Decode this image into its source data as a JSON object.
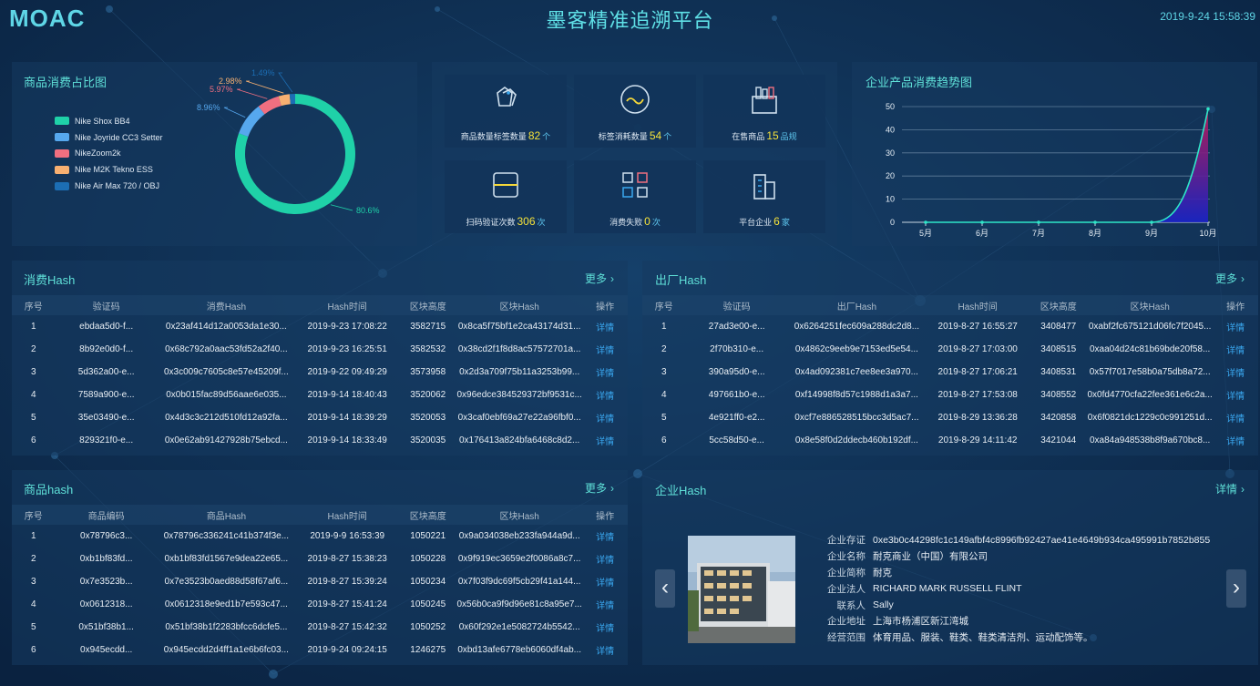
{
  "header": {
    "logo": "MOAC",
    "title": "墨客精准追溯平台",
    "datetime": "2019-9-24 15:58:39"
  },
  "pie_panel": {
    "title": "商品消费占比图",
    "legend": [
      {
        "label": "Nike Shox BB4",
        "color": "#1fd1a8"
      },
      {
        "label": "Nike Joyride CC3 Setter",
        "color": "#56a8ee"
      },
      {
        "label": "NikeZoom2k",
        "color": "#f06f80"
      },
      {
        "label": "Nike M2K Tekno ESS",
        "color": "#f7b071"
      },
      {
        "label": "Nike Air Max 720 / OBJ",
        "color": "#1c6eb4"
      }
    ],
    "labels": [
      "80.6%",
      "8.96%",
      "5.97%",
      "2.98%",
      "1.49%"
    ]
  },
  "chart_data": [
    {
      "type": "pie",
      "title": "商品消费占比图",
      "categories": [
        "Nike Shox BB4",
        "Nike Joyride CC3 Setter",
        "NikeZoom2k",
        "Nike M2K Tekno ESS",
        "Nike Air Max 720 / OBJ"
      ],
      "values": [
        80.6,
        8.96,
        5.97,
        2.98,
        1.49
      ],
      "legend": "left"
    },
    {
      "type": "area",
      "title": "企业产品消费趋势图",
      "categories": [
        "5月",
        "6月",
        "7月",
        "8月",
        "9月",
        "10月"
      ],
      "values": [
        0,
        0,
        0,
        0,
        0,
        49
      ],
      "ylim": [
        0,
        50
      ],
      "yticks": [
        0,
        10,
        20,
        30,
        40,
        50
      ],
      "grid": true
    }
  ],
  "stats": [
    {
      "icon": "tag-icon",
      "label": "商品数量标签数量",
      "value": "82",
      "unit": "个"
    },
    {
      "icon": "wave-circle-icon",
      "label": "标签消耗数量",
      "value": "54",
      "unit": "个"
    },
    {
      "icon": "shopping-bag-icon",
      "label": "在售商品",
      "value": "15",
      "unit": "品规"
    },
    {
      "icon": "scan-icon",
      "label": "扫码验证次数",
      "value": "306",
      "unit": "次"
    },
    {
      "icon": "consume-fail-icon",
      "label": "消费失败",
      "value": "0",
      "unit": "次"
    },
    {
      "icon": "building-icon",
      "label": "平台企业",
      "value": "6",
      "unit": "家"
    }
  ],
  "trend_panel": {
    "title": "企业产品消费趋势图"
  },
  "consume_hash": {
    "title": "消费Hash",
    "more": "更多",
    "columns": [
      "序号",
      "验证码",
      "消费Hash",
      "Hash时间",
      "区块高度",
      "区块Hash",
      "操作"
    ],
    "rows": [
      [
        "1",
        "ebdaa5d0-f...",
        "0x23af414d12a0053da1e30...",
        "2019-9-23 17:08:22",
        "3582715",
        "0x8ca5f75bf1e2ca43174d31...",
        "详情"
      ],
      [
        "2",
        "8b92e0d0-f...",
        "0x68c792a0aac53fd52a2f40...",
        "2019-9-23 16:25:51",
        "3582532",
        "0x38cd2f1f8d8ac57572701a...",
        "详情"
      ],
      [
        "3",
        "5d362a00-e...",
        "0x3c009c7605c8e57e45209f...",
        "2019-9-22 09:49:29",
        "3573958",
        "0x2d3a709f75b11a3253b99...",
        "详情"
      ],
      [
        "4",
        "7589a900-e...",
        "0x0b015fac89d56aae6e035...",
        "2019-9-14 18:40:43",
        "3520062",
        "0x96edce384529372bf9531c...",
        "详情"
      ],
      [
        "5",
        "35e03490-e...",
        "0x4d3c3c212d510fd12a92fa...",
        "2019-9-14 18:39:29",
        "3520053",
        "0x3caf0ebf69a27e22a96fbf0...",
        "详情"
      ],
      [
        "6",
        "829321f0-e...",
        "0x0e62ab91427928b75ebcd...",
        "2019-9-14 18:33:49",
        "3520035",
        "0x176413a824bfa6468c8d2...",
        "详情"
      ]
    ]
  },
  "factory_hash": {
    "title": "出厂Hash",
    "more": "更多",
    "columns": [
      "序号",
      "验证码",
      "出厂Hash",
      "Hash时间",
      "区块高度",
      "区块Hash",
      "操作"
    ],
    "rows": [
      [
        "1",
        "27ad3e00-e...",
        "0x6264251fec609a288dc2d8...",
        "2019-8-27 16:55:27",
        "3408477",
        "0xabf2fc675121d06fc7f2045...",
        "详情"
      ],
      [
        "2",
        "2f70b310-e...",
        "0x4862c9eeb9e7153ed5e54...",
        "2019-8-27 17:03:00",
        "3408515",
        "0xaa04d24c81b69bde20f58...",
        "详情"
      ],
      [
        "3",
        "390a95d0-e...",
        "0x4ad092381c7ee8ee3a970...",
        "2019-8-27 17:06:21",
        "3408531",
        "0x57f7017e58b0a75db8a72...",
        "详情"
      ],
      [
        "4",
        "497661b0-e...",
        "0xf14998f8d57c1988d1a3a7...",
        "2019-8-27 17:53:08",
        "3408552",
        "0x0fd4770cfa22fee361e6c2a...",
        "详情"
      ],
      [
        "5",
        "4e921ff0-e2...",
        "0xcf7e886528515bcc3d5ac7...",
        "2019-8-29 13:36:28",
        "3420858",
        "0x6f0821dc1229c0c991251d...",
        "详情"
      ],
      [
        "6",
        "5cc58d50-e...",
        "0x8e58f0d2ddecb460b192df...",
        "2019-8-29 14:11:42",
        "3421044",
        "0xa84a948538b8f9a670bc8...",
        "详情"
      ]
    ]
  },
  "goods_hash": {
    "title": "商品hash",
    "more": "更多",
    "columns": [
      "序号",
      "商品编码",
      "商品Hash",
      "Hash时间",
      "区块高度",
      "区块Hash",
      "操作"
    ],
    "rows": [
      [
        "1",
        "0x78796c3...",
        "0x78796c336241c41b374f3e...",
        "2019-9-9 16:53:39",
        "1050221",
        "0x9a034038eb233fa944a9d...",
        "详情"
      ],
      [
        "2",
        "0xb1bf83fd...",
        "0xb1bf83fd1567e9dea22e65...",
        "2019-8-27 15:38:23",
        "1050228",
        "0x9f919ec3659e2f0086a8c7...",
        "详情"
      ],
      [
        "3",
        "0x7e3523b...",
        "0x7e3523b0aed88d58f67af6...",
        "2019-8-27 15:39:24",
        "1050234",
        "0x7f03f9dc69f5cb29f41a144...",
        "详情"
      ],
      [
        "4",
        "0x0612318...",
        "0x0612318e9ed1b7e593c47...",
        "2019-8-27 15:41:24",
        "1050245",
        "0x56b0ca9f9d96e81c8a95e7...",
        "详情"
      ],
      [
        "5",
        "0x51bf38b1...",
        "0x51bf38b1f2283bfcc6dcfe5...",
        "2019-8-27 15:42:32",
        "1050252",
        "0x60f292e1e5082724b5542...",
        "详情"
      ],
      [
        "6",
        "0x945ecdd...",
        "0x945ecdd2d4ff1a1e6b6fc03...",
        "2019-9-24 09:24:15",
        "1246275",
        "0xbd13afe6778eb6060df4ab...",
        "详情"
      ]
    ]
  },
  "enterprise": {
    "title": "企业Hash",
    "detail": "详情",
    "prev": "‹",
    "next": "›",
    "fields": [
      {
        "k": "企业存证",
        "v": "0xe3b0c44298fc1c149afbf4c8996fb92427ae41e4649b934ca495991b7852b855"
      },
      {
        "k": "企业名称",
        "v": "耐克商业（中国）有限公司"
      },
      {
        "k": "企业简称",
        "v": "耐克"
      },
      {
        "k": "企业法人",
        "v": "RICHARD MARK RUSSELL FLINT"
      },
      {
        "k": "联系人",
        "v": "Sally"
      },
      {
        "k": "企业地址",
        "v": "上海市杨浦区新江湾城"
      },
      {
        "k": "经营范围",
        "v": "体育用品、服装、鞋类、鞋类清洁剂、运动配饰等。"
      }
    ]
  }
}
